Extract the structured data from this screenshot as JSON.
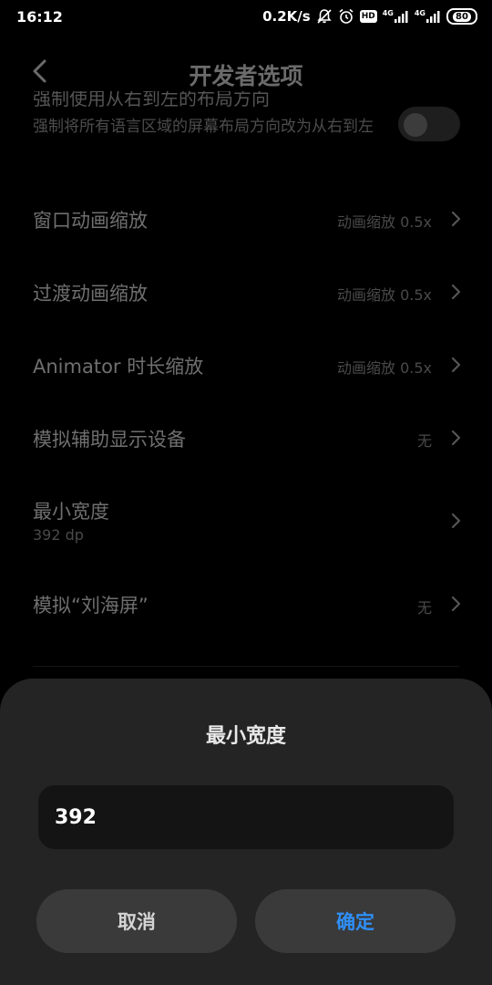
{
  "statusbar": {
    "time": "16:12",
    "network_speed": "0.2K/s",
    "icons": [
      "bell-off-icon",
      "alarm-clock-icon",
      "hd-badge-icon",
      "signal-4g-icon",
      "signal-4g-icon",
      "battery-icon"
    ],
    "hd": "HD",
    "net1": "4G",
    "net2": "4G",
    "battery": "80"
  },
  "header": {
    "title": "开发者选项",
    "back_icon": "chevron-left-icon"
  },
  "settings": {
    "cut_title": "强制使用从右到左的布局方向",
    "rtl_description": "强制将所有语言区域的屏幕布局方向改为从右到左",
    "rtl_toggle": "off",
    "window_anim": {
      "label": "窗口动画缩放",
      "value": "动画缩放 0.5x"
    },
    "transition_anim": {
      "label": "过渡动画缩放",
      "value": "动画缩放 0.5x"
    },
    "animator": {
      "label": "Animator 时长缩放",
      "value": "动画缩放 0.5x"
    },
    "secondary_display": {
      "label": "模拟辅助显示设备",
      "value": "无"
    },
    "smallest_width": {
      "label": "最小宽度",
      "sub": "392 dp"
    },
    "notch": {
      "label": "模拟“刘海屏”",
      "value": "无"
    }
  },
  "dialog": {
    "title": "最小宽度",
    "input_value": "392",
    "cancel_label": "取消",
    "ok_label": "确定"
  },
  "colors": {
    "accent": "#2f8ff7",
    "dialog_bg": "#242424",
    "input_bg": "#141414",
    "button_bg": "#3a3a3a"
  }
}
